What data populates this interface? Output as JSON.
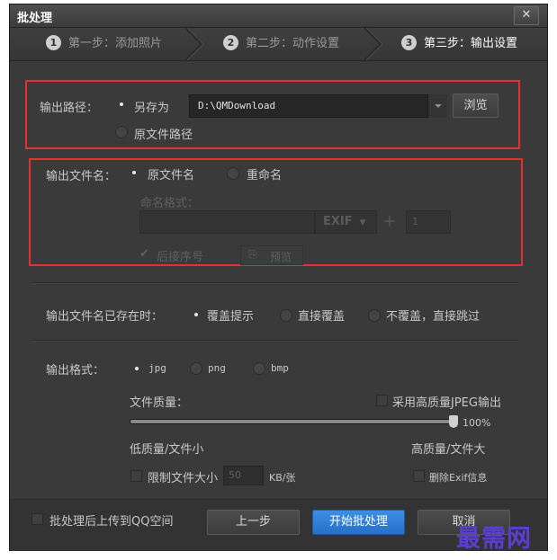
{
  "window": {
    "title": "批处理",
    "close_glyph": "✕"
  },
  "steps": [
    {
      "num": "1",
      "label": "第一步：添加照片"
    },
    {
      "num": "2",
      "label": "第二步：动作设置"
    },
    {
      "num": "3",
      "label": "第三步：输出设置"
    }
  ],
  "output_path": {
    "label": "输出路径：",
    "save_as": "另存为",
    "path_value": "D:\\QMDownload",
    "browse": "浏览",
    "original_path": "原文件路径"
  },
  "output_filename": {
    "label": "输出文件名：",
    "original_name": "原文件名",
    "rename": "重命名",
    "format_label": "命名格式：",
    "exif": "EXIF",
    "plus": "＋",
    "seq_start": "1",
    "append_seq": "后接序号",
    "preview": "预览"
  },
  "exists": {
    "label": "输出文件名已存在时：",
    "prompt": "覆盖提示",
    "overwrite": "直接覆盖",
    "skip": "不覆盖，直接跳过"
  },
  "format": {
    "label": "输出格式：",
    "jpg": "jpg",
    "png": "png",
    "bmp": "bmp",
    "quality_label": "文件质量：",
    "hq_jpeg": "采用高质量JPEG输出",
    "quality_value": "100%",
    "quality_fraction": 1.0,
    "low_label": "低质量/文件小",
    "high_label": "高质量/文件大",
    "limit_size": "限制文件大小",
    "size_value": "50",
    "size_unit": "KB/张",
    "remove_exif": "删除Exif信息"
  },
  "footer": {
    "upload_qq": "批处理后上传到QQ空间",
    "prev": "上一步",
    "start": "开始批处理",
    "cancel": "取消"
  },
  "watermark": "最需网",
  "colors": {
    "accent": "#2b7bd6",
    "highlight": "#e53030",
    "background": "#3a3a3a"
  }
}
